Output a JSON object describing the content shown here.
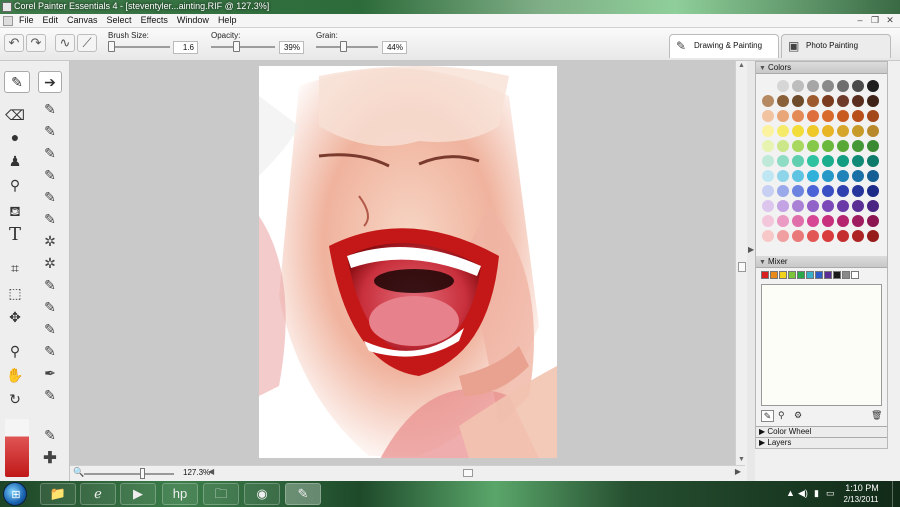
{
  "window": {
    "title": "Corel Painter Essentials 4 - [steventyler...ainting.RIF @ 127.3%]"
  },
  "menu": {
    "items": [
      "File",
      "Edit",
      "Canvas",
      "Select",
      "Effects",
      "Window",
      "Help"
    ]
  },
  "window_controls": {
    "minimize": "–",
    "restore": "❐",
    "close": "✕"
  },
  "propbar": {
    "brush_size": {
      "label": "Brush Size:",
      "value": "1.6",
      "level": 0.05
    },
    "opacity": {
      "label": "Opacity:",
      "value": "39%",
      "level": 0.39
    },
    "grain": {
      "label": "Grain:",
      "value": "44%",
      "level": 0.44
    },
    "tabs": [
      {
        "label": "Drawing & Painting",
        "icon": "brush-icon",
        "active": true
      },
      {
        "label": "Photo Painting",
        "icon": "photo-icon",
        "active": false
      }
    ]
  },
  "toolbox": {
    "tools": [
      "brush-tool",
      "dropper-tool",
      "paint-bucket-tool",
      "eraser-tool",
      "cloner-tool",
      "text-tool",
      "crop-tool",
      "selection-tool",
      "transform-tool",
      "magnifier-tool",
      "grabber-tool",
      "rotate-page-tool"
    ]
  },
  "canvas": {
    "zoom": "127.3%"
  },
  "panels": {
    "colors": {
      "title": "Colors",
      "swatches": [
        "#f2f2f2",
        "#d6d6d6",
        "#bdbdbd",
        "#a6a6a6",
        "#8a8a8a",
        "#6e6e6e",
        "#4b4b4b",
        "#1e1e1e",
        "#b58a62",
        "#8a6038",
        "#6e4b2a",
        "#9c5a2e",
        "#7a3b1e",
        "#6e3b2a",
        "#5a2e1e",
        "#3f2318",
        "#f1c3a0",
        "#e9a679",
        "#e48a57",
        "#df6e3d",
        "#d86b2b",
        "#c85a20",
        "#b84e1a",
        "#a3481a",
        "#fbf3a0",
        "#f6ea6a",
        "#f2dd3a",
        "#efc82a",
        "#e7b526",
        "#d6a62a",
        "#c79a2a",
        "#b8892a",
        "#e7f3b0",
        "#cbe78a",
        "#a8d860",
        "#86c84a",
        "#6ab83c",
        "#58a838",
        "#449836",
        "#3a8a34",
        "#bfe9d8",
        "#8fdcc4",
        "#5fcfb0",
        "#2fc2a0",
        "#1aae8e",
        "#129c82",
        "#108a76",
        "#0e7a6a",
        "#bfe7f3",
        "#8fd5ea",
        "#5fc3e2",
        "#2fb1da",
        "#2598c8",
        "#1f82b8",
        "#1a70a6",
        "#155e94",
        "#c7cff3",
        "#9aa9ea",
        "#6d83e0",
        "#4a63d6",
        "#3a4fc4",
        "#2e40b0",
        "#25359c",
        "#1c2a88",
        "#dcc6ee",
        "#c3a3e3",
        "#a982d6",
        "#9162c8",
        "#7c4ab8",
        "#6a3aa6",
        "#5a2e94",
        "#4a2482",
        "#f3c6dc",
        "#ea9ac3",
        "#e06eab",
        "#d64694",
        "#c8307e",
        "#b5246e",
        "#a01c60",
        "#8c1652",
        "#f6c8c8",
        "#f0a0a0",
        "#ea7a7a",
        "#e25656",
        "#d83c3c",
        "#c42e2e",
        "#ad2424",
        "#961c1c"
      ]
    },
    "mixer": {
      "title": "Mixer",
      "colors": [
        "#d92020",
        "#e88a1a",
        "#f2d21a",
        "#7cc43a",
        "#2aa84a",
        "#3ab0c8",
        "#2e5cc8",
        "#5a2e94",
        "#1a1a1a",
        "#8a8a8a",
        "#ffffff"
      ]
    },
    "color_wheel": {
      "title": "Color Wheel"
    },
    "layers": {
      "title": "Layers"
    }
  },
  "taskbar": {
    "apps": [
      "explorer-icon",
      "ie-icon",
      "media-player-icon",
      "hp-icon",
      "folder-icon",
      "chrome-icon",
      "painter-icon"
    ],
    "time": "1:10 PM",
    "date": "2/13/2011"
  }
}
